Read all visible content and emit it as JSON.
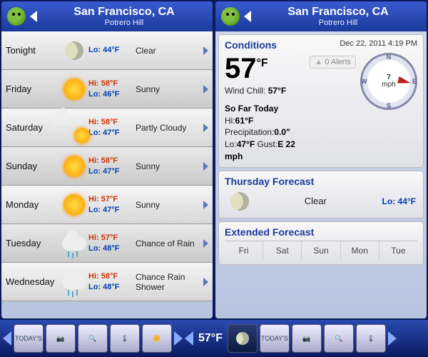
{
  "header": {
    "title": "San Francisco, CA",
    "subtitle": "Potrero Hill"
  },
  "forecast7": [
    {
      "day": "Tonight",
      "icon": "moon",
      "hi": "",
      "lo": "Lo: 44°F",
      "cond": "Clear"
    },
    {
      "day": "Friday",
      "icon": "sun",
      "hi": "Hi: 58°F",
      "lo": "Lo: 46°F",
      "cond": "Sunny"
    },
    {
      "day": "Saturday",
      "icon": "partly",
      "hi": "Hi: 58°F",
      "lo": "Lo: 47°F",
      "cond": "Partly Cloudy"
    },
    {
      "day": "Sunday",
      "icon": "sun",
      "hi": "Hi: 58°F",
      "lo": "Lo: 47°F",
      "cond": "Sunny"
    },
    {
      "day": "Monday",
      "icon": "sun",
      "hi": "Hi: 57°F",
      "lo": "Lo: 47°F",
      "cond": "Sunny"
    },
    {
      "day": "Tuesday",
      "icon": "rain",
      "hi": "Hi: 57°F",
      "lo": "Lo: 48°F",
      "cond": "Chance of Rain"
    },
    {
      "day": "Wednesday",
      "icon": "rain",
      "hi": "Hi: 58°F",
      "lo": "Lo: 48°F",
      "cond": "Chance Rain Shower"
    }
  ],
  "conditions": {
    "label": "Conditions",
    "timestamp": "Dec 22, 2011 4:19 PM",
    "temp": "57",
    "unit": "°F",
    "windchill_label": "Wind Chill:",
    "windchill": "57°F",
    "sofar_label": "So Far Today",
    "hi_label": "Hi:",
    "hi": "61°F",
    "precip_label": "Precipitation:",
    "precip": "0.0\"",
    "lo_label": "Lo:",
    "lo": "47°F",
    "gust_label": "Gust:",
    "gust": "E 22 mph",
    "wind_speed": "7",
    "wind_unit": "mph",
    "alerts": "0 Alerts",
    "compass": {
      "n": "N",
      "s": "S",
      "e": "E",
      "w": "W"
    }
  },
  "today_forecast": {
    "title": "Thursday Forecast",
    "cond": "Clear",
    "lo": "Lo: 44°F"
  },
  "extended": {
    "title": "Extended Forecast",
    "days": [
      "Fri",
      "Sat",
      "Sun",
      "Mon",
      "Tue"
    ]
  },
  "bottombar": {
    "temp": "57°F"
  }
}
